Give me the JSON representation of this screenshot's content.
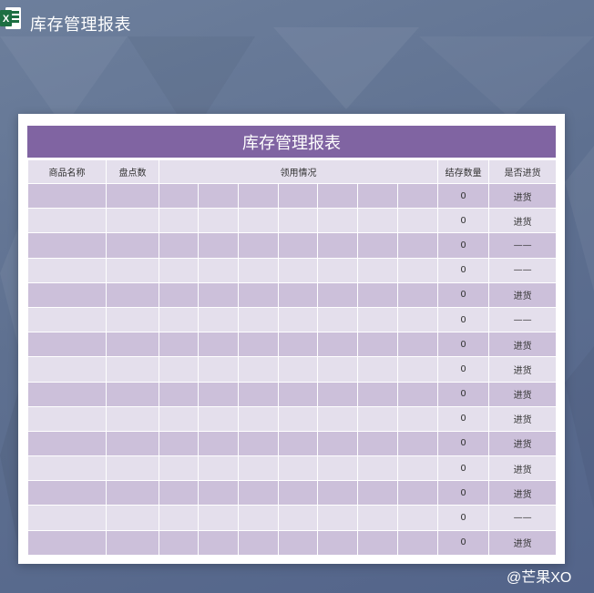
{
  "app": {
    "title": "库存管理报表",
    "icon": "excel-icon"
  },
  "sheet": {
    "banner_title": "库存管理报表",
    "headers": [
      "商品名称",
      "盘点数",
      "领用情况",
      "结存数量",
      "是否进货"
    ],
    "rows": [
      {
        "stock": "0",
        "restock": "进货"
      },
      {
        "stock": "0",
        "restock": "进货"
      },
      {
        "stock": "0",
        "restock": "——"
      },
      {
        "stock": "0",
        "restock": "——"
      },
      {
        "stock": "0",
        "restock": "进货"
      },
      {
        "stock": "0",
        "restock": "——"
      },
      {
        "stock": "0",
        "restock": "进货"
      },
      {
        "stock": "0",
        "restock": "进货"
      },
      {
        "stock": "0",
        "restock": "进货"
      },
      {
        "stock": "0",
        "restock": "进货"
      },
      {
        "stock": "0",
        "restock": "进货"
      },
      {
        "stock": "0",
        "restock": "进货"
      },
      {
        "stock": "0",
        "restock": "进货"
      },
      {
        "stock": "0",
        "restock": "——"
      },
      {
        "stock": "0",
        "restock": "进货"
      }
    ]
  },
  "watermark": "@芒果XO",
  "colors": {
    "banner": "#8064a2",
    "row_dark": "#ccc0da",
    "row_light": "#e4dfec",
    "background": "#5e7090",
    "excel_green": "#1d6f42"
  }
}
